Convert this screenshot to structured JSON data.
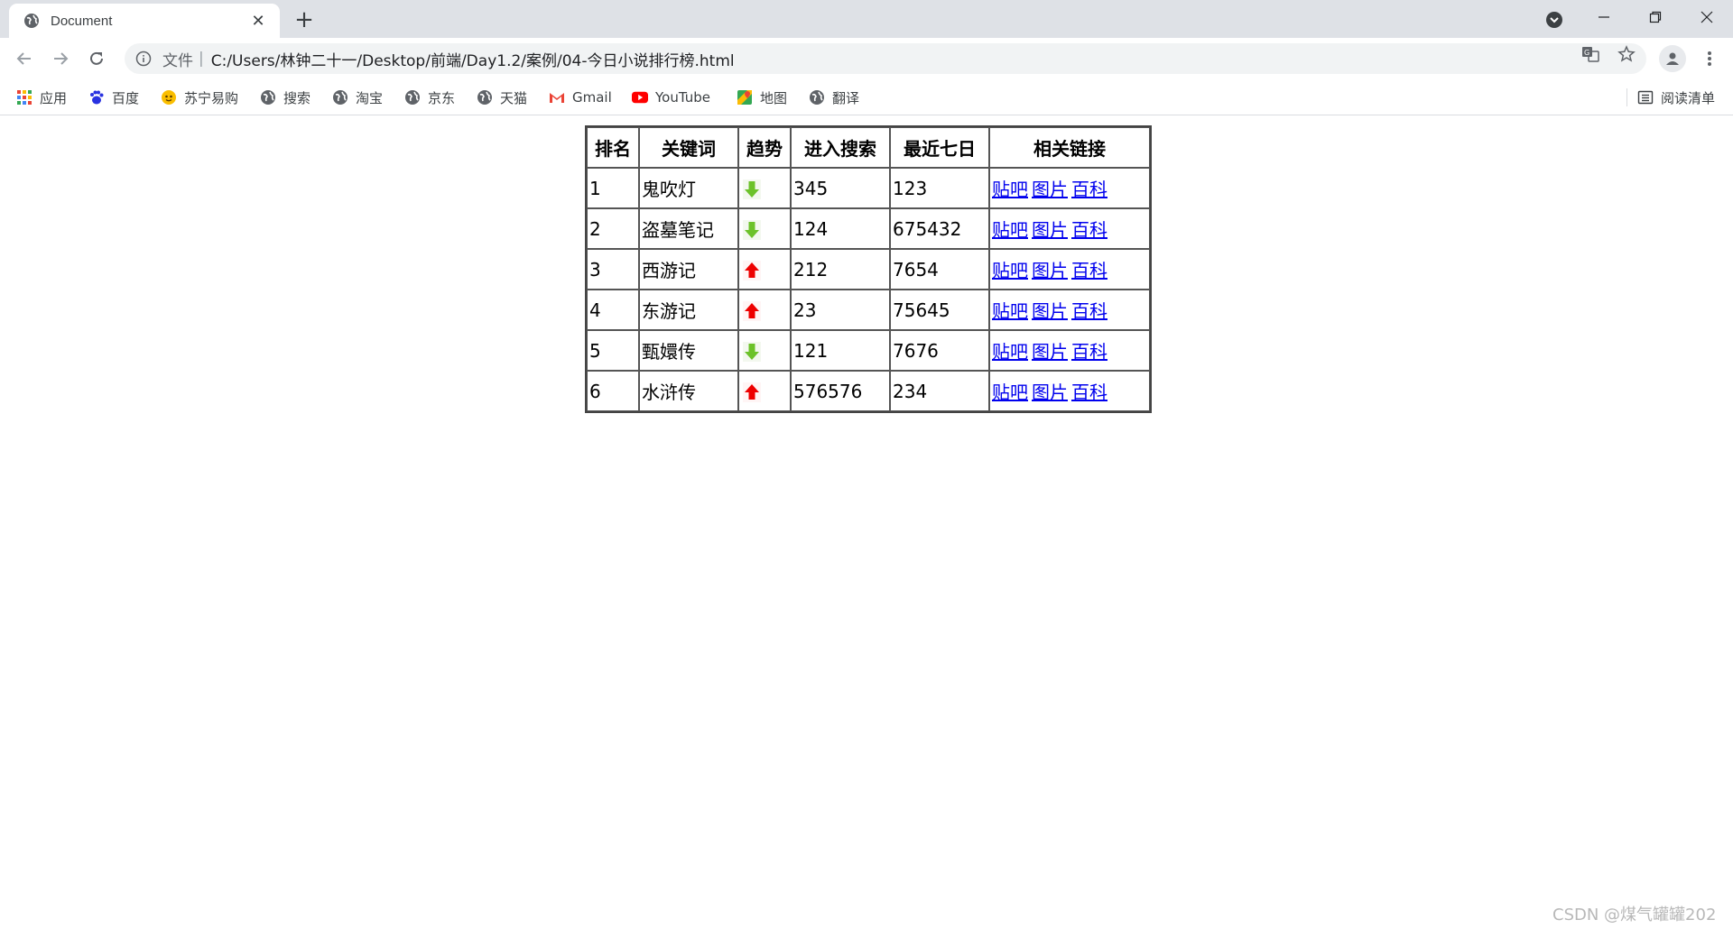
{
  "browser": {
    "tab_title": "Document",
    "url_scheme": "文件",
    "url": "C:/Users/林钟二十一/Desktop/前端/Day1.2/案例/04-今日小说排行榜.html",
    "bookmarks": [
      {
        "label": "应用",
        "icon": "apps-grid-icon"
      },
      {
        "label": "百度",
        "icon": "baidu-paw-icon"
      },
      {
        "label": "苏宁易购",
        "icon": "suning-icon"
      },
      {
        "label": "搜索",
        "icon": "globe-icon"
      },
      {
        "label": "淘宝",
        "icon": "globe-icon"
      },
      {
        "label": "京东",
        "icon": "globe-icon"
      },
      {
        "label": "天猫",
        "icon": "globe-icon"
      },
      {
        "label": "Gmail",
        "icon": "gmail-icon"
      },
      {
        "label": "YouTube",
        "icon": "youtube-icon"
      },
      {
        "label": "地图",
        "icon": "maps-icon"
      },
      {
        "label": "翻译",
        "icon": "globe-icon"
      }
    ],
    "reading_list": "阅读清单"
  },
  "table": {
    "headers": [
      "排名",
      "关键词",
      "趋势",
      "进入搜索",
      "最近七日",
      "相关链接"
    ],
    "rows": [
      {
        "rank": "1",
        "keyword": "鬼吹灯",
        "trend": "down",
        "search": "345",
        "week": "123"
      },
      {
        "rank": "2",
        "keyword": "盗墓笔记",
        "trend": "down",
        "search": "124",
        "week": "675432"
      },
      {
        "rank": "3",
        "keyword": "西游记",
        "trend": "up",
        "search": "212",
        "week": "7654"
      },
      {
        "rank": "4",
        "keyword": "东游记",
        "trend": "up",
        "search": "23",
        "week": "75645"
      },
      {
        "rank": "5",
        "keyword": "甄嬛传",
        "trend": "down",
        "search": "121",
        "week": "7676"
      },
      {
        "rank": "6",
        "keyword": "水浒传",
        "trend": "up",
        "search": "576576",
        "week": "234"
      }
    ],
    "links": [
      "贴吧",
      "图片",
      "百科"
    ],
    "colors": {
      "down_arrow": "#6cc22a",
      "up_arrow": "#ee0000",
      "link": "#0000ee"
    }
  },
  "watermark": "CSDN @煤气罐罐202"
}
